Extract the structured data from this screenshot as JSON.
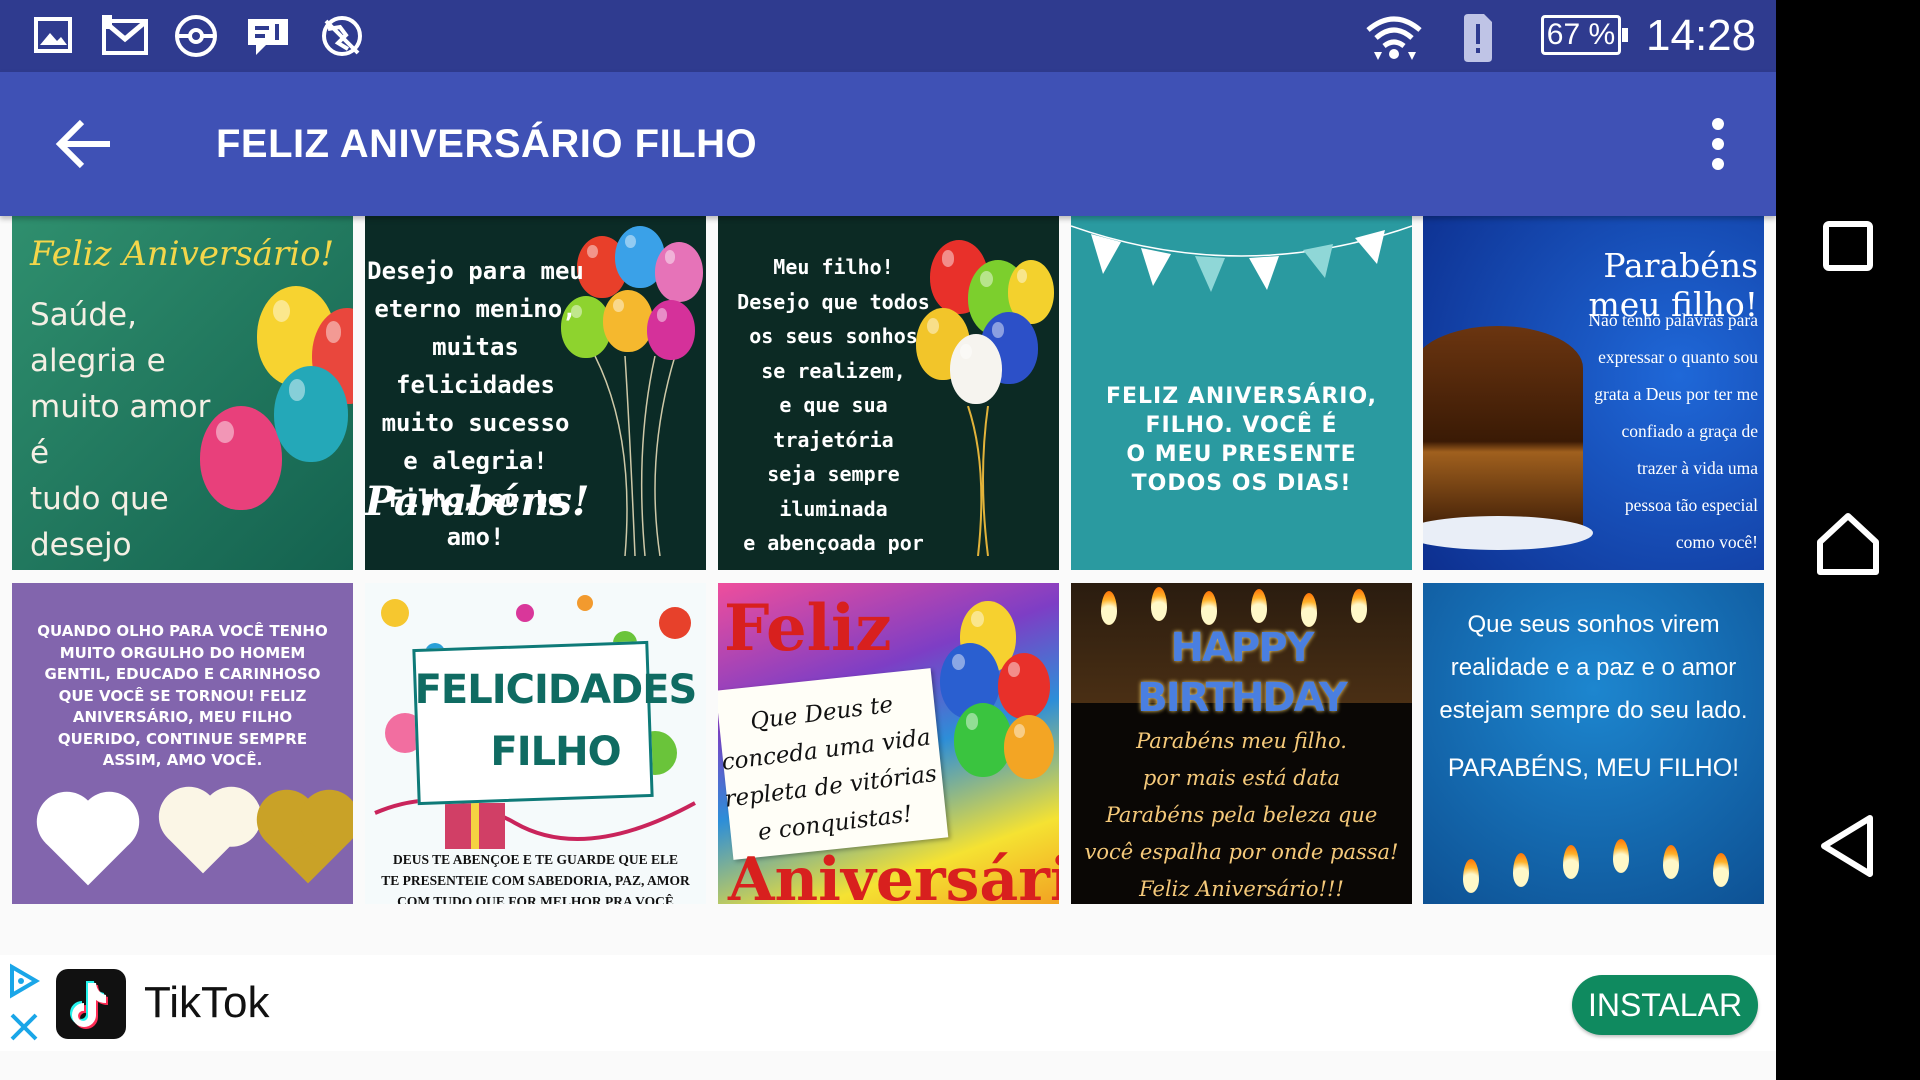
{
  "status_bar": {
    "icons": [
      "gallery-icon",
      "gmail-icon",
      "pokeball-icon",
      "message-icon",
      "no-location-icon"
    ],
    "right_icons": [
      "wifi-icon",
      "alert-sim-icon"
    ],
    "battery": "67 %",
    "time": "14:28"
  },
  "toolbar": {
    "title": "FELIZ ANIVERSÁRIO FILHO",
    "back_icon": "arrow-left-icon",
    "menu_icon": "more-vert-icon"
  },
  "cards": [
    {
      "heading": "Feliz Aniversário!",
      "text": "Saúde, alegria e\nmuito amor é\ntudo que desejo\npara seu dia,\nmeu filho."
    },
    {
      "text": "Desejo para meu\neterno menino,\nmuitas felicidades\nmuito sucesso\ne alegria!\nFilho, eu te amo!",
      "signature": "Parabéns!"
    },
    {
      "text": "Meu filho!\nDesejo que todos\nos seus sonhos\nse realizem,\ne que sua trajetória\nseja sempre iluminada\ne abençoada por Deus!\nFeliz Aniversário!"
    },
    {
      "text": "FELIZ ANIVERSÁRIO,\nFILHO. VOCÊ É\nO MEU PRESENTE\nTODOS OS DIAS!"
    },
    {
      "heading": "Parabéns meu filho!",
      "text": "Não tenho palavras para\nexpressar o quanto sou\ngrata a Deus por ter me\nconfiado a graça de\ntrazer à vida uma\npessoa tão especial\ncomo você!"
    },
    {
      "text": "QUANDO OLHO PARA VOCÊ TENHO\nMUITO ORGULHO DO HOMEM\nGENTIL, EDUCADO E CARINHOSO\nQUE VOCÊ SE TORNOU! FELIZ\nANIVERSÁRIO, MEU FILHO\nQUERIDO, CONTINUE SEMPRE\nASSIM, AMO VOCÊ."
    },
    {
      "heading": "FELICIDADES\nFILHO",
      "text": "DEUS TE ABENÇOE E TE GUARDE QUE ELE\nTE PRESENTEIE COM SABEDORIA, PAZ, AMOR\nCOM TUDO QUE FOR MELHOR PRA VOCÊ"
    },
    {
      "heading": "Feliz",
      "text": "Que Deus te\nconceda uma vida\nrepleta de vitórias\ne conquistas!",
      "footer": "Aniversário"
    },
    {
      "heading": "HAPPY BIRTHDAY",
      "text": "Parabéns meu filho.\npor mais está data\nParabéns pela beleza que\nvocê espalha por onde passa!\nFeliz Aniversário!!!"
    },
    {
      "text": "Que seus sonhos virem\nrealidade e a paz e o amor\nestejam sempre do seu lado.",
      "heading": "PARABÉNS, MEU FILHO!"
    }
  ],
  "ad": {
    "app_name": "TikTok",
    "install_label": "INSTALAR",
    "ad_choices_icon": "ad-choices-icon",
    "close_icon": "close-icon"
  },
  "navigation": [
    "recents-icon",
    "home-icon",
    "back-triangle-icon"
  ]
}
